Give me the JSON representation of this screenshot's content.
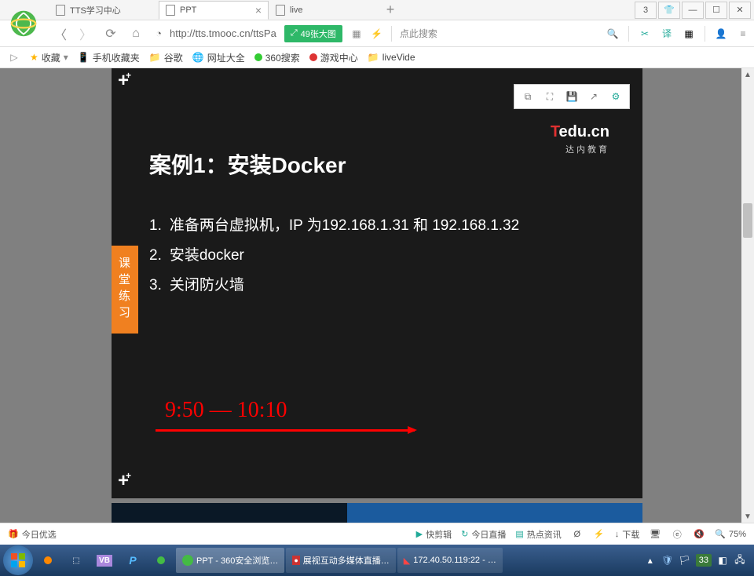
{
  "tabs": {
    "t0": "TTS学习中心",
    "t1": "PPT",
    "t2": "live",
    "count": "3"
  },
  "address": {
    "url": "http://tts.tmooc.cn/ttsPa",
    "badge": "49张大图",
    "search_hint": "点此搜索"
  },
  "bookmarks": {
    "fav": "收藏",
    "mobile": "手机收藏夹",
    "google": "谷歌",
    "sites": "网址大全",
    "s360": "360搜索",
    "game": "游戏中心",
    "live": "liveVide"
  },
  "slide": {
    "title": "案例1：安装Docker",
    "item1_num": "1.",
    "item1_text": "准备两台虚拟机，IP 为192.168.1.31 和 192.168.1.32",
    "item2_num": "2.",
    "item2_text": "安装docker",
    "item3_num": "3.",
    "item3_text": "关闭防火墙",
    "sidetag": "课堂练习",
    "brand_t": "T",
    "brand_rest": "edu.cn",
    "brand_sub": "达内教育",
    "annotation": "9:50 — 10:10"
  },
  "bottombar": {
    "today": "今日优选",
    "clip": "快剪辑",
    "live": "今日直播",
    "hot": "热点资讯",
    "down": "下载",
    "zoom": "75%"
  },
  "taskbar": {
    "t_ppt": "PPT - 360安全浏览…",
    "t_media": "展视互动多媒体直播…",
    "t_ip": "172.40.50.119:22 - …",
    "tray_num": "33"
  }
}
